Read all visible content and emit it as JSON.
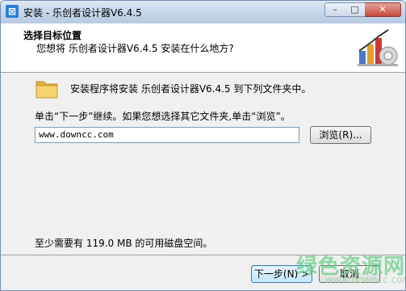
{
  "window": {
    "title": "安装 - 乐创者设计器V6.4.5",
    "app_icon_glyph": "⊠",
    "minimize_glyph": "–",
    "maximize_glyph": "□",
    "close_glyph": "✕"
  },
  "header": {
    "title": "选择目标位置",
    "subtitle": "您想将 乐创者设计器V6.4.5 安装在什么地方?"
  },
  "body": {
    "install_message": "安装程序将安装 乐创者设计器V6.4.5 到下列文件夹中。",
    "instruction": "单击“下一步”继续。如果您想选择其它文件夹,单击“浏览”。",
    "path_value": "www.downcc.com",
    "browse_label": "浏览(R)...",
    "space_message": "至少需要有 119.0 MB 的可用磁盘空间。"
  },
  "footer": {
    "next_label": "下一步(N) >",
    "cancel_label": "取消"
  },
  "watermark": {
    "text": "绿色资源网",
    "url": "www.downcc.com"
  },
  "colors": {
    "accent": "#2a7fd4",
    "folder": "#f2c94c",
    "watermark": "#6ccf8a"
  }
}
